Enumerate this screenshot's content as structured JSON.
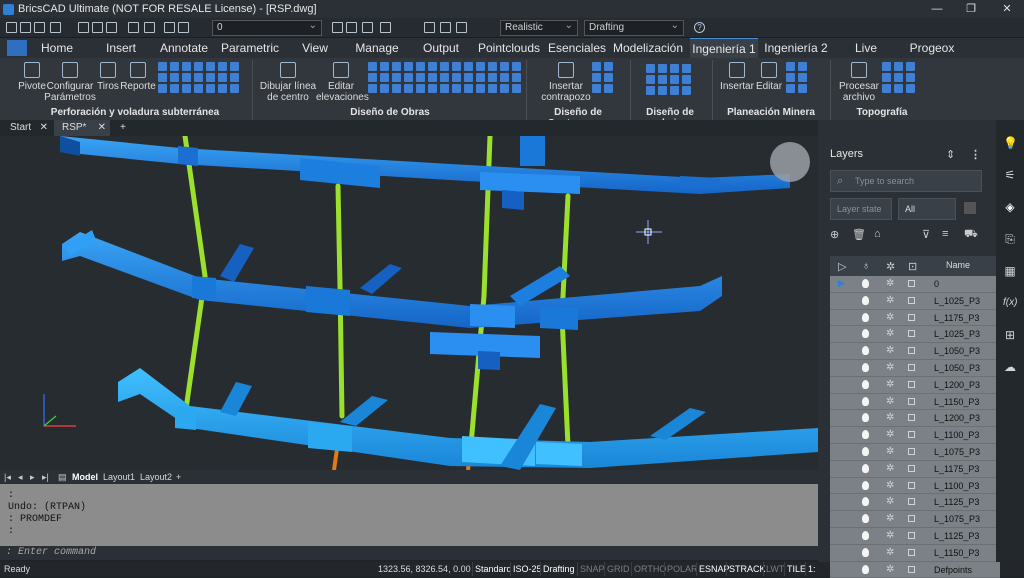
{
  "title": "BricsCAD Ultimate (NOT FOR RESALE License) - [RSP.dwg]",
  "window_controls": {
    "min": "—",
    "max": "❐",
    "close": "✕"
  },
  "qat": {
    "layer_value": "0",
    "visual_style": "Realistic",
    "workspace": "Drafting",
    "help": "?"
  },
  "tabs": [
    "Home",
    "Insert",
    "Annotate",
    "Parametric",
    "View",
    "Manage",
    "Output",
    "Pointclouds",
    "Esenciales",
    "Modelización",
    "Ingeniería 1",
    "Ingeniería 2",
    "Live Survey",
    "Progeox"
  ],
  "active_tab": "Ingeniería 1",
  "ribbon": {
    "buttons": [
      {
        "label": "Pivote"
      },
      {
        "label": "Configurar\nParámetros"
      },
      {
        "label": "Tiros"
      },
      {
        "label": "Reporte"
      },
      {
        "label": "Dibujar línea\nde centro"
      },
      {
        "label": "Editar\nelevaciones"
      },
      {
        "label": "Insertar\ncontrapozo"
      },
      {
        "label": "Insertar"
      },
      {
        "label": "Editar"
      },
      {
        "label": "Procesar\narchivo"
      }
    ],
    "groups": [
      "Perforación y voladura subterránea",
      "Diseño de Obras",
      "Diseño de Contrapozos",
      "Diseño de rebajes",
      "Planeación Minera",
      "Topografía"
    ]
  },
  "doc_tabs": {
    "start": "Start",
    "active": "RSP*",
    "add": "+"
  },
  "layout_tabs": {
    "model": "Model",
    "l1": "Layout1",
    "l2": "Layout2",
    "add": "+"
  },
  "command": {
    "lines": [
      ":",
      "Undo: (RTPAN)",
      ": PROMDEF",
      ":"
    ],
    "prompt": ": Enter command"
  },
  "status": {
    "ready": "Ready",
    "coords": "1323.56, 8326.54, 0.00",
    "items": [
      {
        "t": "Standard",
        "on": true
      },
      {
        "t": "ISO-25",
        "on": true
      },
      {
        "t": "Drafting",
        "on": true
      },
      {
        "t": "SNAP",
        "on": false
      },
      {
        "t": "GRID",
        "on": false
      },
      {
        "t": "ORTHO",
        "on": false
      },
      {
        "t": "POLAR",
        "on": false
      },
      {
        "t": "ESNAP",
        "on": true
      },
      {
        "t": "STRACK",
        "on": true
      },
      {
        "t": "LWT",
        "on": false
      },
      {
        "t": "TILE",
        "on": true
      },
      {
        "t": "1:",
        "on": true
      }
    ]
  },
  "panel": {
    "title": "Layers",
    "search_placeholder": "Type to search",
    "layer_state_placeholder": "Layer state",
    "filter_value": "All",
    "column_name": "Name",
    "layers": [
      "0",
      "L_1025_P3",
      "L_1175_P3",
      "L_1025_P3",
      "L_1050_P3",
      "L_1050_P3",
      "L_1200_P3",
      "L_1150_P3",
      "L_1200_P3",
      "L_1100_P3",
      "L_1075_P3",
      "L_1175_P3",
      "L_1100_P3",
      "L_1125_P3",
      "L_1075_P3",
      "L_1125_P3",
      "L_1150_P3",
      "Defpoints"
    ]
  },
  "colors": {
    "tunnel": "#1f8fe8",
    "tunnel_light": "#2aa8f0",
    "shaft": "#9be02c",
    "accent": "#4a90d9"
  },
  "icons": [
    "lightbulb-icon",
    "sliders-icon",
    "layers-icon",
    "paperclip-icon",
    "grid-icon",
    "fx-icon",
    "tree-icon",
    "cloud-upload-icon"
  ]
}
